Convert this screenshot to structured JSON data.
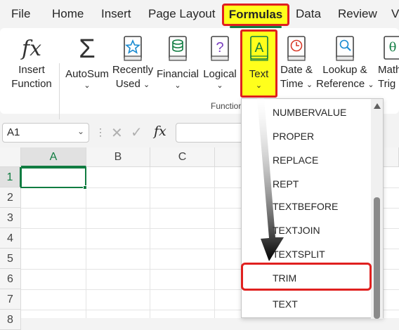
{
  "menu": {
    "items": [
      "File",
      "Home",
      "Insert",
      "Page Layout",
      "Formulas",
      "Data",
      "Review",
      "V"
    ],
    "active": "Formulas"
  },
  "ribbon": {
    "insert_function": {
      "line1": "Insert",
      "line2": "Function",
      "icon": "fx-icon"
    },
    "autosum": {
      "label": "AutoSum",
      "icon": "sigma-icon"
    },
    "recently_used": {
      "line1": "Recently",
      "line2": "Used",
      "icon": "star-book-icon"
    },
    "financial": {
      "label": "Financial",
      "icon": "database-book-icon"
    },
    "logical": {
      "label": "Logical",
      "icon": "question-book-icon"
    },
    "text": {
      "label": "Text",
      "icon": "text-A-book-icon"
    },
    "date_time": {
      "line1": "Date &",
      "line2": "Time",
      "icon": "clock-book-icon"
    },
    "lookup_reference": {
      "line1": "Lookup &",
      "line2": "Reference",
      "icon": "magnifier-book-icon"
    },
    "math_trig": {
      "line1": "Math",
      "line2": "Trig",
      "icon": "theta-book-icon"
    },
    "group_label": "Function"
  },
  "formula_bar": {
    "name_box": "A1",
    "fx": "fx",
    "formula": ""
  },
  "grid": {
    "columns": [
      "A",
      "B",
      "C"
    ],
    "rows": [
      "1",
      "2",
      "3",
      "4",
      "5",
      "6",
      "7",
      "8"
    ],
    "active_cell": "A1"
  },
  "dropdown": {
    "items": [
      "NUMBERVALUE",
      "PROPER",
      "REPLACE",
      "REPT",
      "TEXTBEFORE",
      "TEXTJOIN",
      "TEXTSPLIT",
      "TRIM",
      "TEXT"
    ],
    "highlighted": "TRIM"
  },
  "colors": {
    "highlight_yellow": "#ffff1c",
    "highlight_red": "#e0201f",
    "excel_green": "#107c41"
  }
}
